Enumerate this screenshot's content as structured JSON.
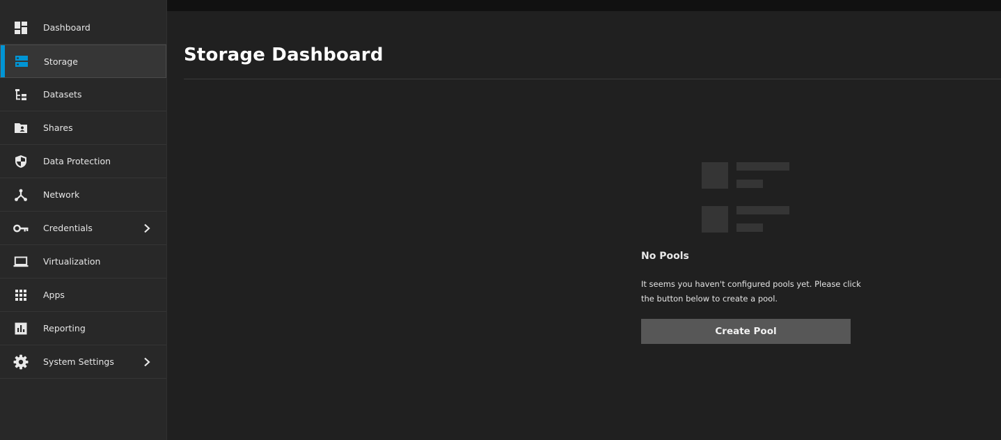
{
  "sidebar": {
    "items": [
      {
        "label": "Dashboard",
        "icon": "dashboard-icon"
      },
      {
        "label": "Storage",
        "icon": "storage-icon",
        "active": true
      },
      {
        "label": "Datasets",
        "icon": "datasets-icon"
      },
      {
        "label": "Shares",
        "icon": "shares-folder-icon"
      },
      {
        "label": "Data Protection",
        "icon": "shield-icon"
      },
      {
        "label": "Network",
        "icon": "network-icon"
      },
      {
        "label": "Credentials",
        "icon": "key-icon",
        "expandable": true
      },
      {
        "label": "Virtualization",
        "icon": "laptop-icon"
      },
      {
        "label": "Apps",
        "icon": "apps-grid-icon"
      },
      {
        "label": "Reporting",
        "icon": "reporting-chart-icon"
      },
      {
        "label": "System Settings",
        "icon": "gear-icon",
        "expandable": true
      }
    ]
  },
  "main": {
    "title": "Storage Dashboard",
    "empty_state": {
      "title": "No Pools",
      "message": "It seems you haven't configured pools yet. Please click the button below to create a pool.",
      "button_label": "Create Pool"
    }
  },
  "colors": {
    "accent": "#0095d5",
    "background": "#202020",
    "sidebar": "#282828",
    "button": "#575757"
  }
}
